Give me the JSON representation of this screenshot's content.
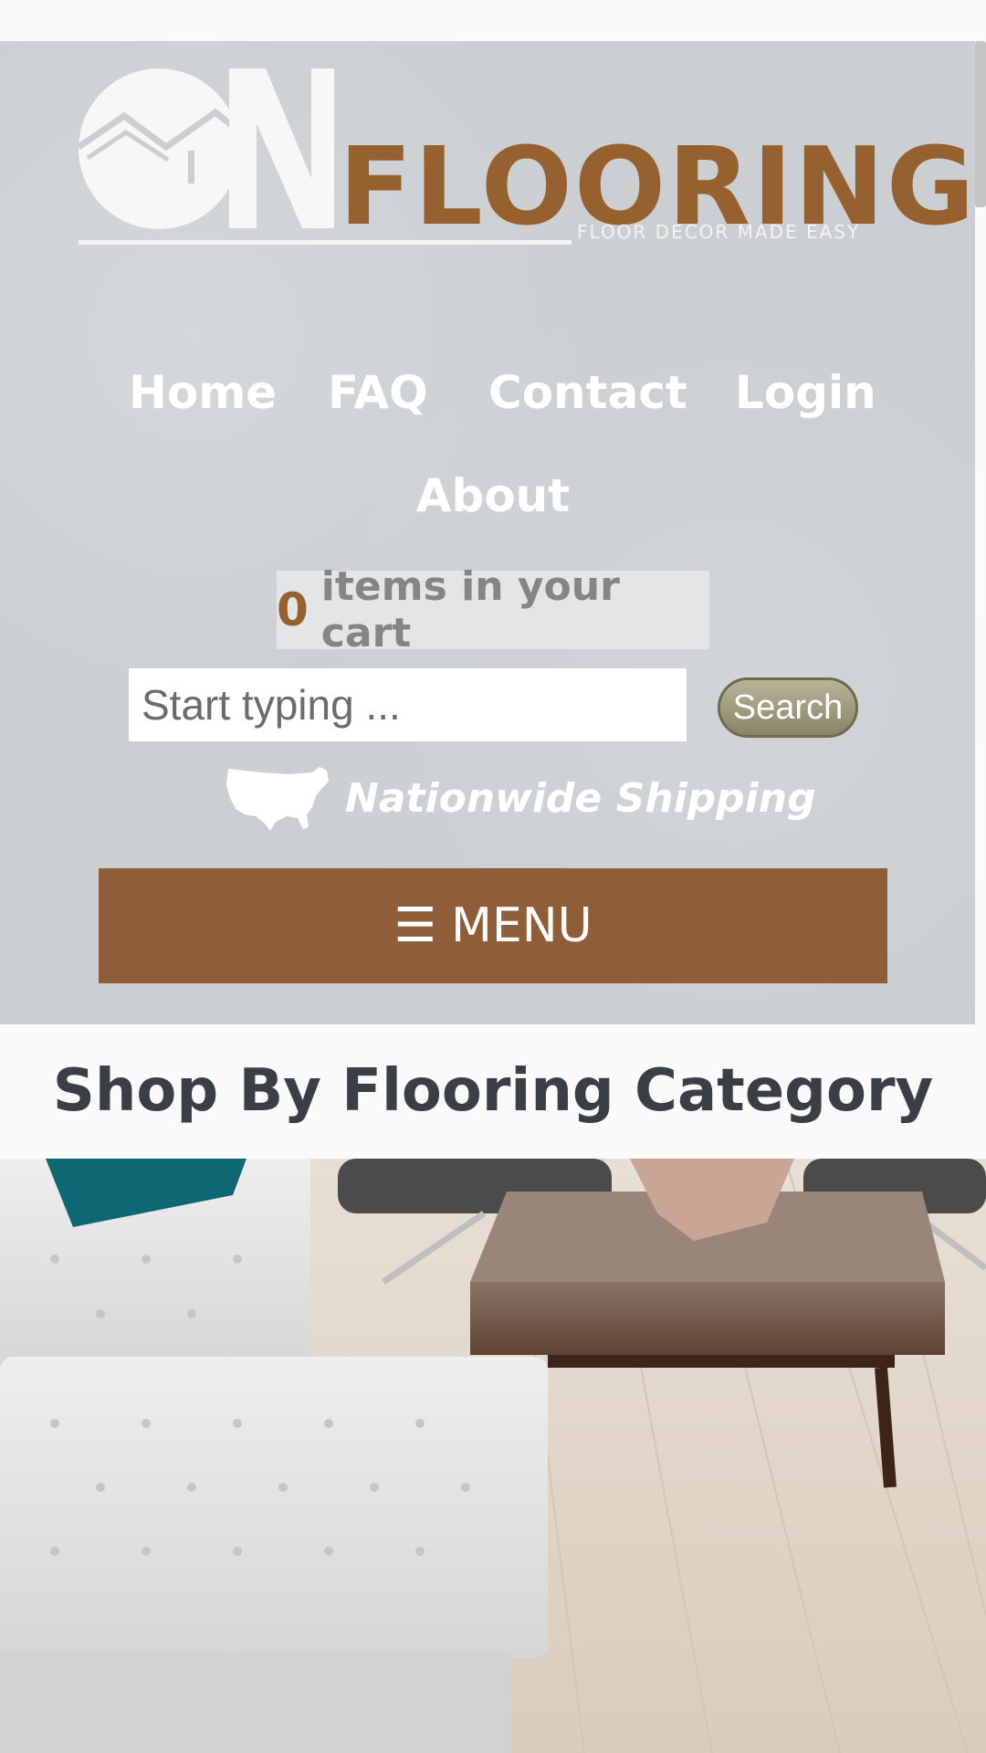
{
  "brand": {
    "logo_on": "ON",
    "logo_name": "FLOORING",
    "tagline": "FLOOR DECOR MADE EASY",
    "accent_color": "#96602f"
  },
  "nav": {
    "items": [
      {
        "label": "Home"
      },
      {
        "label": "FAQ"
      },
      {
        "label": "Contact"
      },
      {
        "label": "Login"
      },
      {
        "label": "About"
      }
    ]
  },
  "cart": {
    "count": "0",
    "label": "items in your cart"
  },
  "search": {
    "placeholder": "Start typing ...",
    "button_label": "Search"
  },
  "shipping": {
    "text": "Nationwide Shipping",
    "icon": "usa-map-icon"
  },
  "menu": {
    "icon": "☰",
    "label": "MENU",
    "color": "#8f5e38"
  },
  "section": {
    "title": "Shop By Flooring Category"
  }
}
